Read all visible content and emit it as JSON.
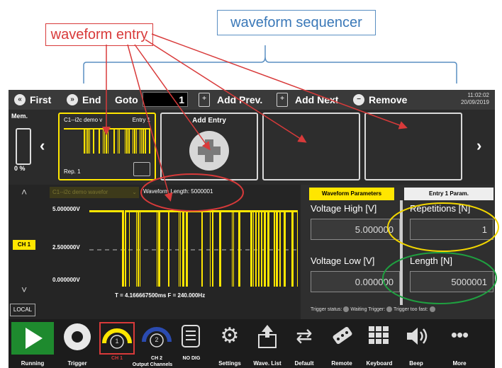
{
  "annotations": {
    "waveform_entry": "waveform entry",
    "waveform_sequencer": "waveform sequencer"
  },
  "toolbar": {
    "first": "First",
    "end": "End",
    "goto": "Goto",
    "goto_value": "1",
    "add_prev": "Add Prev.",
    "add_next": "Add Next",
    "remove": "Remove",
    "time": "11:02:02",
    "date": "20/09/2019"
  },
  "sequencer": {
    "mem_label": "Mem.",
    "mem_percent": "0 %",
    "entry1": {
      "name": "C1--i2c demo v",
      "entry": "Entry 1",
      "rep": "Rep. 1"
    },
    "add_entry": "Add Entry"
  },
  "wave": {
    "selector": "C1--i2c demo wavefor",
    "length_label": "Waveform Length: 5000001",
    "y_top": "5.000000V",
    "y_mid": "2.500000V",
    "y_bot": "0.000000V",
    "channel": "CH 1",
    "footer": "T = 4.166667500ms  F = 240.000Hz",
    "local": "LOCAL"
  },
  "params": {
    "tab_waveform": "Waveform Parameters",
    "tab_entry": "Entry 1 Param.",
    "voltage_high_label": "Voltage High [V]",
    "voltage_high_value": "5.000000",
    "voltage_low_label": "Voltage Low [V]",
    "voltage_low_value": "0.000000",
    "repetitions_label": "Repetitions [N]",
    "repetitions_value": "1",
    "length_label": "Length [N]",
    "length_value": "5000001",
    "trigger_status": "Trigger status:",
    "waiting_trigger": "Waiting Trigger:",
    "trigger_too_fast": "Trigger too fast:"
  },
  "bottom": {
    "running": "Running",
    "trigger": "Trigger",
    "output_channels": "Output Channels",
    "ch1": "CH 1",
    "ch2": "CH 2",
    "ch1_num": "1",
    "ch2_num": "2",
    "no_dig": "NO DIG",
    "settings": "Settings",
    "wave_list": "Wave. List",
    "default": "Default",
    "remote": "Remote",
    "keyboard": "Keyboard",
    "beep": "Beep",
    "more": "More"
  },
  "colors": {
    "accent_yellow": "#ffe600",
    "annotation_red": "#d83a3a",
    "annotation_blue": "#3a78b8",
    "circle_yellow": "#f2d600",
    "circle_green": "#1fa040",
    "play_green": "#1e8a2e"
  }
}
